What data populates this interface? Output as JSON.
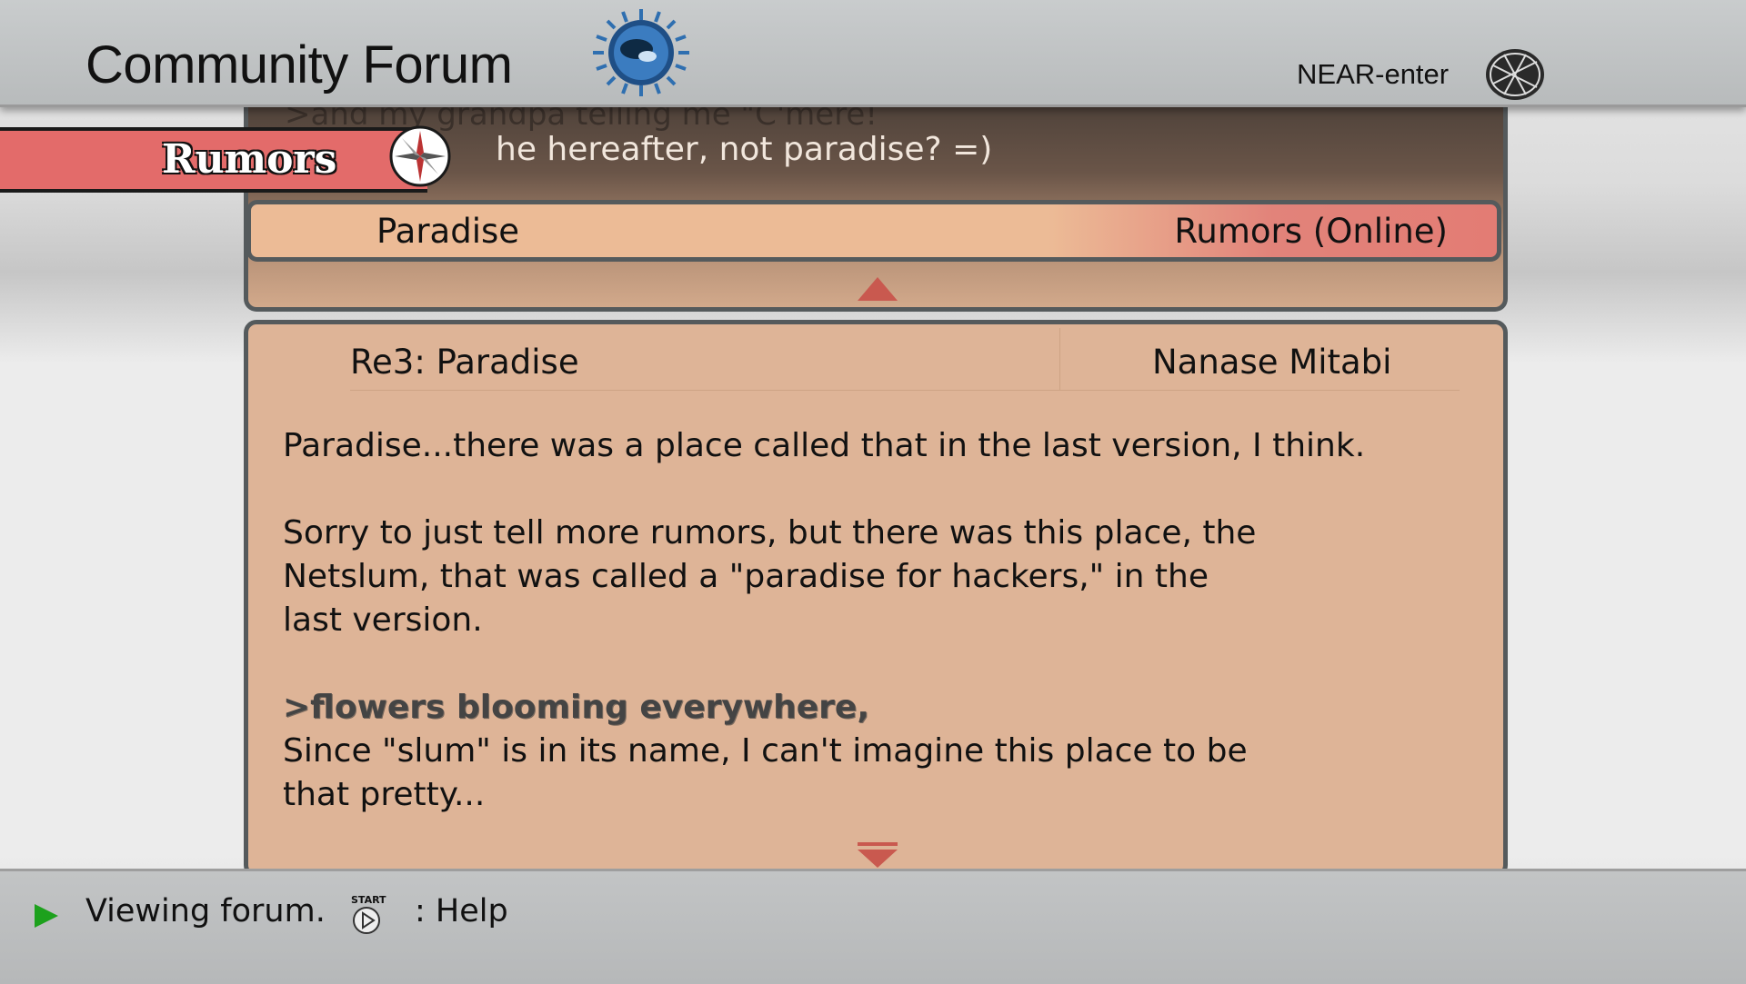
{
  "header": {
    "title": "Community Forum",
    "user": "NEAR-enter"
  },
  "category_tag": {
    "label": "Rumors"
  },
  "previous_post": {
    "quote_fragment": ">and my grandpa telling me \"C'mere!",
    "text_fragment": "he hereafter, not paradise? =)",
    "subject": "Paradise",
    "board": "Rumors (Online)"
  },
  "post": {
    "subject": "Re3: Paradise",
    "author": "Nanase Mitabi",
    "paragraph_1": "Paradise...there was a place called that in the last version, I think.",
    "paragraph_2": "Sorry to just tell more rumors, but there was this place, the Netslum, that was called a \"paradise for hackers,\" in the last version.",
    "quote": ">flowers blooming everywhere,",
    "paragraph_3": "Since \"slum\" is in its name, I can't imagine this place to be that pretty..."
  },
  "footer": {
    "status": "Viewing forum.",
    "start_label": "START",
    "help": ": Help"
  },
  "colors": {
    "tag": "#e36b6a",
    "header_bar_left": "#ecbb96",
    "header_bar_right": "#e37c74",
    "panel": "#deb497",
    "play": "#1da11d"
  },
  "icons": [
    "globe-logo-icon",
    "net-globe-icon",
    "compass-icon",
    "up-arrow-icon",
    "down-arrow-icon",
    "play-icon",
    "start-button-icon"
  ]
}
